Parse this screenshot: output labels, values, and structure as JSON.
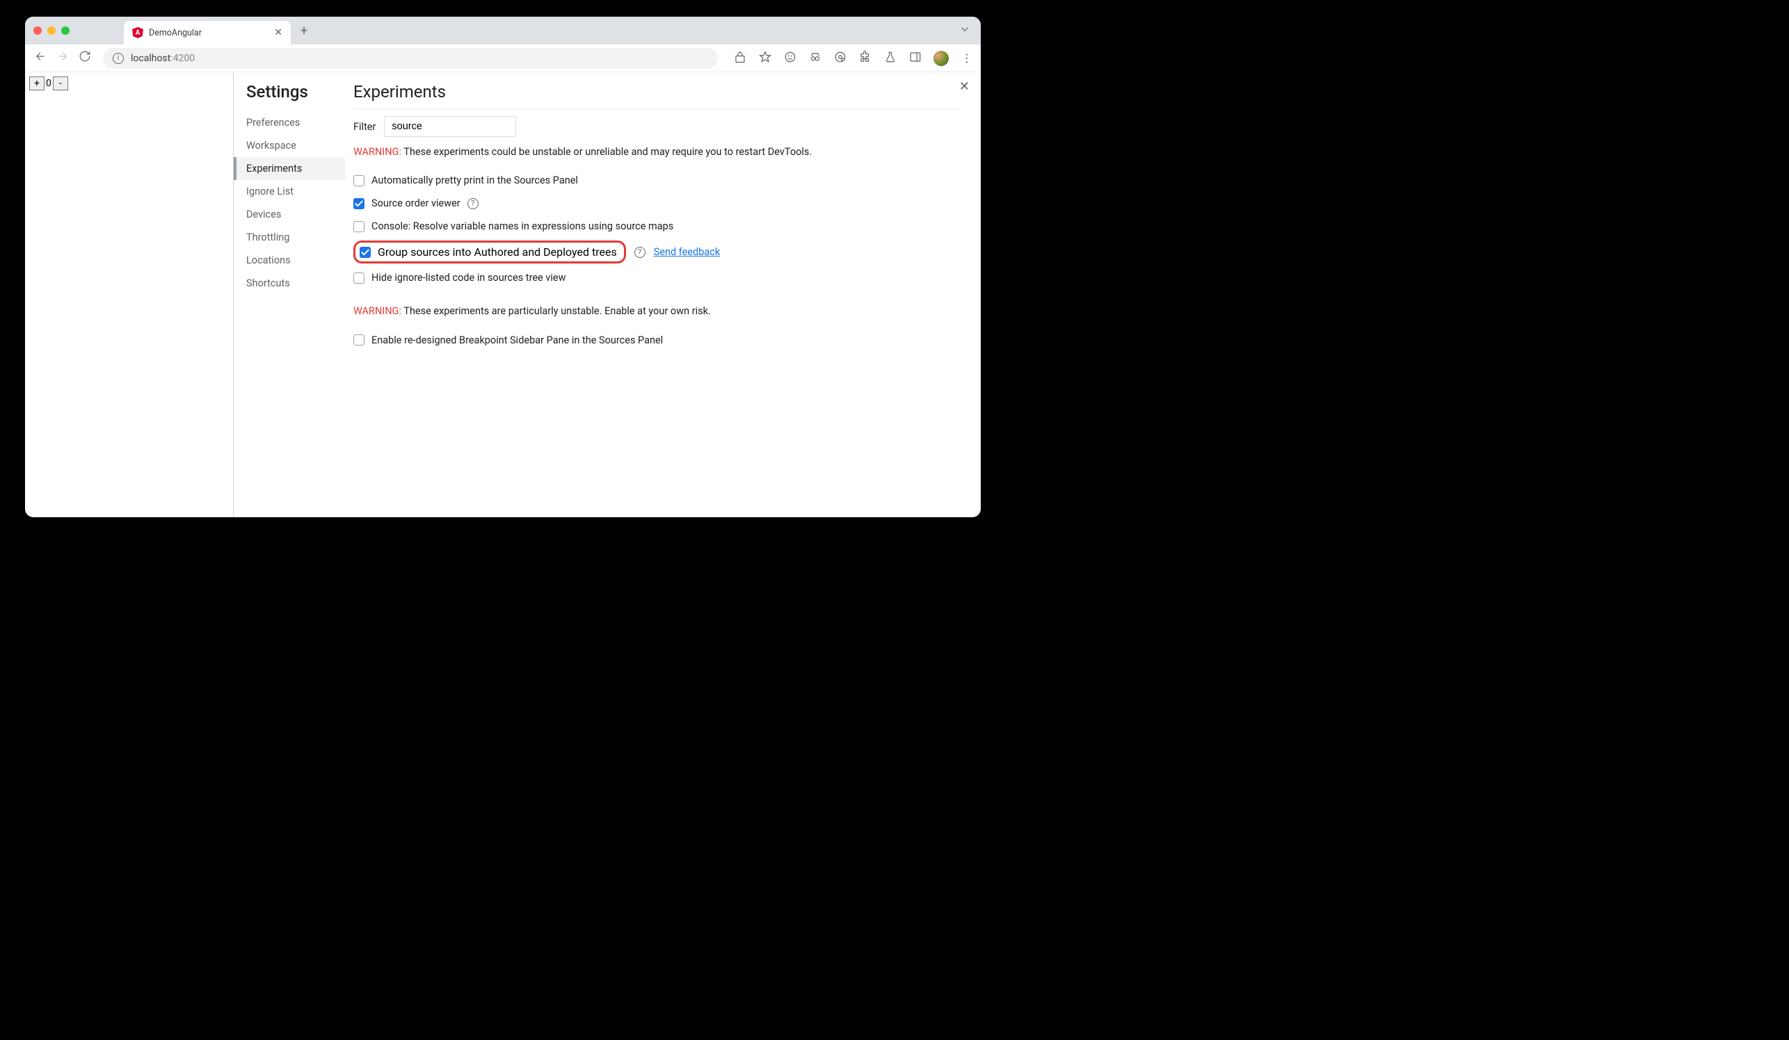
{
  "browser": {
    "tab_title": "DemoAngular",
    "url_host": "localhost",
    "url_port": ":4200"
  },
  "counter": {
    "plus": "+",
    "value": "0",
    "minus": "-"
  },
  "settings_title": "Settings",
  "nav": {
    "preferences": "Preferences",
    "workspace": "Workspace",
    "experiments": "Experiments",
    "ignore_list": "Ignore List",
    "devices": "Devices",
    "throttling": "Throttling",
    "locations": "Locations",
    "shortcuts": "Shortcuts"
  },
  "experiments": {
    "heading": "Experiments",
    "filter_label": "Filter",
    "filter_value": "source",
    "warning1_label": "WARNING:",
    "warning1_text": " These experiments could be unstable or unreliable and may require you to restart DevTools.",
    "items": {
      "pretty_print": "Automatically pretty print in the Sources Panel",
      "source_order": "Source order viewer",
      "console_resolve": "Console: Resolve variable names in expressions using source maps",
      "group_sources": "Group sources into Authored and Deployed trees",
      "hide_ignore": "Hide ignore-listed code in sources tree view"
    },
    "feedback_link": "Send feedback",
    "warning2_label": "WARNING:",
    "warning2_text": " These experiments are particularly unstable. Enable at your own risk.",
    "breakpoint_item": "Enable re-designed Breakpoint Sidebar Pane in the Sources Panel"
  }
}
